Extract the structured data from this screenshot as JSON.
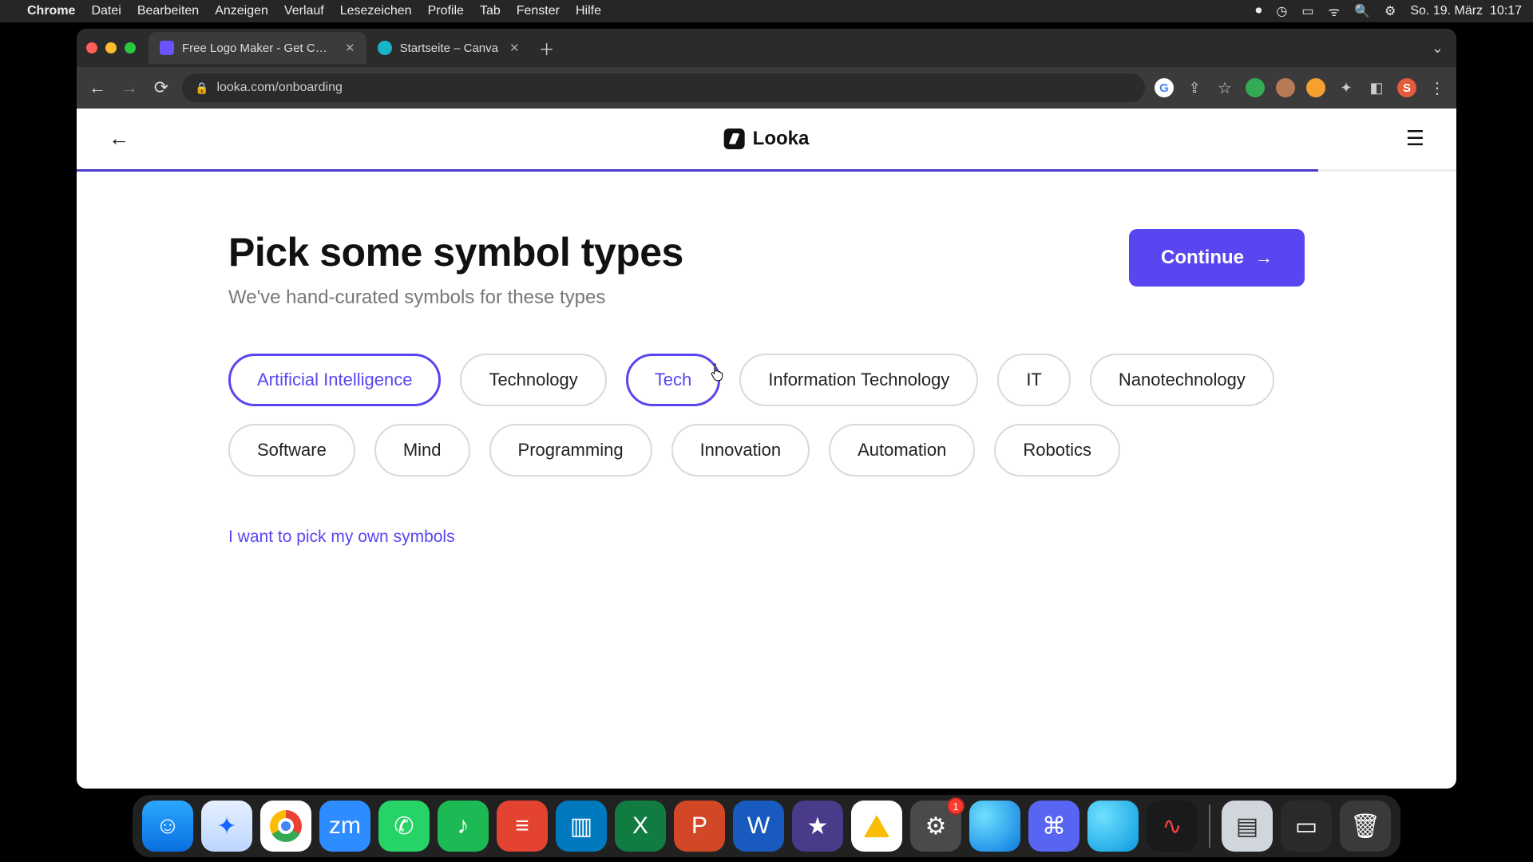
{
  "menubar": {
    "app_name": "Chrome",
    "items": [
      "Datei",
      "Bearbeiten",
      "Anzeigen",
      "Verlauf",
      "Lesezeichen",
      "Profile",
      "Tab",
      "Fenster",
      "Hilfe"
    ],
    "date": "So. 19. März",
    "time": "10:17"
  },
  "tabs": [
    {
      "title": "Free Logo Maker - Get Custom…",
      "active": true,
      "favicon": "purple"
    },
    {
      "title": "Startseite – Canva",
      "active": false,
      "favicon": "teal"
    }
  ],
  "url": "looka.com/onboarding",
  "toolbar_profile_initial": "S",
  "page": {
    "brand": "Looka",
    "progress_percent": 90,
    "heading": "Pick some symbol types",
    "subheading": "We've hand-curated symbols for these types",
    "continue_label": "Continue",
    "own_symbols_link": "I want to pick my own symbols",
    "chips": [
      {
        "label": "Artificial Intelligence",
        "selected": true
      },
      {
        "label": "Technology",
        "selected": false
      },
      {
        "label": "Tech",
        "selected": true
      },
      {
        "label": "Information Technology",
        "selected": false
      },
      {
        "label": "IT",
        "selected": false
      },
      {
        "label": "Nanotechnology",
        "selected": false
      },
      {
        "label": "Software",
        "selected": false
      },
      {
        "label": "Mind",
        "selected": false
      },
      {
        "label": "Programming",
        "selected": false
      },
      {
        "label": "Innovation",
        "selected": false
      },
      {
        "label": "Automation",
        "selected": false
      },
      {
        "label": "Robotics",
        "selected": false
      }
    ]
  },
  "dock": {
    "apps": [
      {
        "name": "finder",
        "glyph": "☺"
      },
      {
        "name": "safari",
        "glyph": "✦"
      },
      {
        "name": "chrome",
        "glyph": ""
      },
      {
        "name": "zoom",
        "glyph": "zm"
      },
      {
        "name": "whatsapp",
        "glyph": "✆"
      },
      {
        "name": "spotify",
        "glyph": "♪"
      },
      {
        "name": "todoist",
        "glyph": "≡"
      },
      {
        "name": "trello",
        "glyph": "▥"
      },
      {
        "name": "excel",
        "glyph": "X"
      },
      {
        "name": "ppt",
        "glyph": "P"
      },
      {
        "name": "word",
        "glyph": "W"
      },
      {
        "name": "imovie",
        "glyph": "★"
      },
      {
        "name": "gdrive",
        "glyph": ""
      },
      {
        "name": "settings",
        "glyph": "⚙",
        "badge": "1"
      },
      {
        "name": "globe",
        "glyph": ""
      },
      {
        "name": "discord",
        "glyph": "⌘"
      },
      {
        "name": "qt",
        "glyph": ""
      },
      {
        "name": "audio",
        "glyph": "∿"
      }
    ],
    "extras": [
      {
        "name": "preview",
        "glyph": "▤"
      },
      {
        "name": "desktop",
        "glyph": "▭"
      },
      {
        "name": "trash",
        "glyph": "🗑"
      }
    ]
  }
}
